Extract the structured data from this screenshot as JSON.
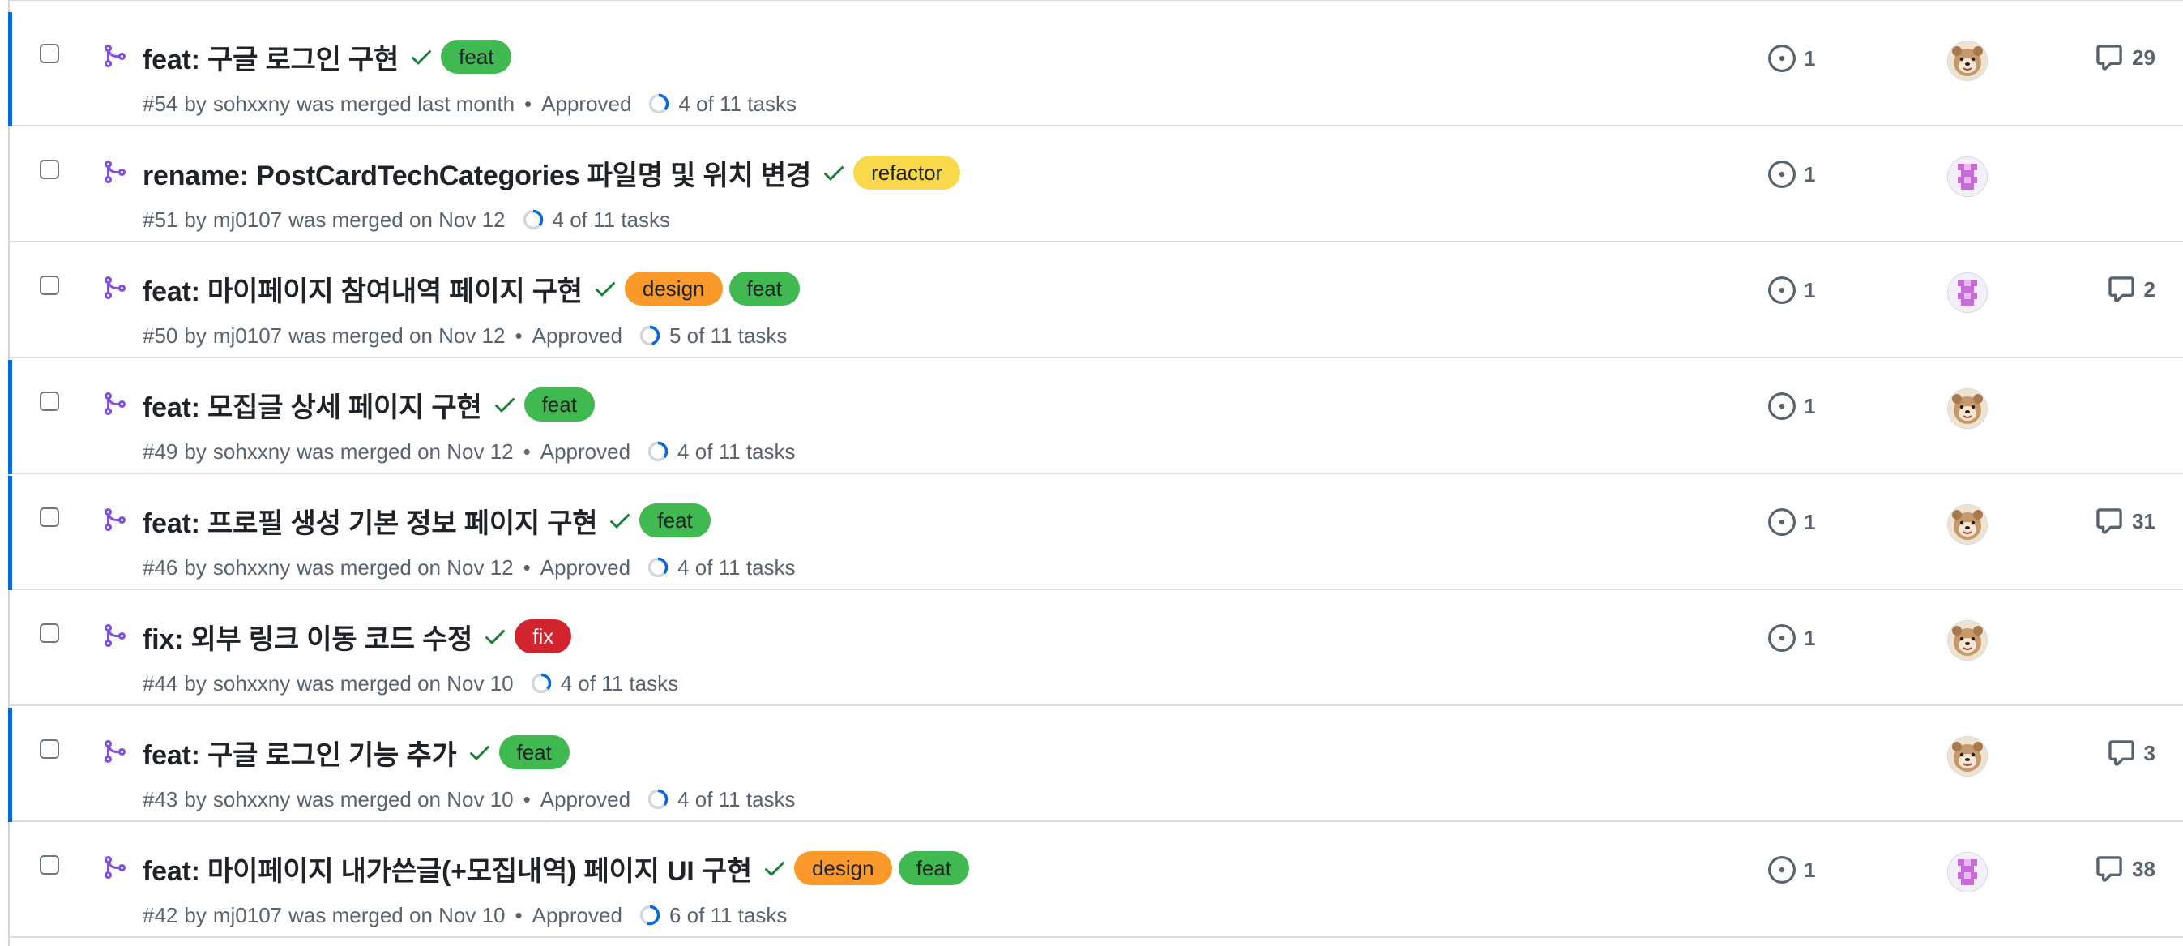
{
  "colors": {
    "feat": "#3fb950",
    "refactor": "#f9d849",
    "design": "#fb9a2b",
    "fix": "#d1242f",
    "merged_purple": "#8250df",
    "check_green": "#1a7f37",
    "progress_blue": "#0969da",
    "unread_bar": "#0969da"
  },
  "prs": [
    {
      "title": "feat: 구글 로그인 구현",
      "labels": [
        {
          "text": "feat",
          "color": "feat"
        }
      ],
      "number": "#54",
      "by": "by",
      "author": "sohxxny",
      "merged": "was merged last month",
      "approved": "Approved",
      "tasks": "4 of 11 tasks",
      "tasks_done": 4,
      "tasks_total": 11,
      "issues": "1",
      "avatar": "bear",
      "comments": "29",
      "unread": true
    },
    {
      "title": "rename: PostCardTechCategories 파일명 및 위치 변경",
      "labels": [
        {
          "text": "refactor",
          "color": "refactor"
        }
      ],
      "number": "#51",
      "by": "by",
      "author": "mj0107",
      "merged": "was merged on Nov 12",
      "approved": "",
      "tasks": "4 of 11 tasks",
      "tasks_done": 4,
      "tasks_total": 11,
      "issues": "1",
      "avatar": "pixel",
      "comments": "",
      "unread": false
    },
    {
      "title": "feat: 마이페이지 참여내역 페이지 구현",
      "labels": [
        {
          "text": "design",
          "color": "design"
        },
        {
          "text": "feat",
          "color": "feat"
        }
      ],
      "number": "#50",
      "by": "by",
      "author": "mj0107",
      "merged": "was merged on Nov 12",
      "approved": "Approved",
      "tasks": "5 of 11 tasks",
      "tasks_done": 5,
      "tasks_total": 11,
      "issues": "1",
      "avatar": "pixel",
      "comments": "2",
      "unread": false
    },
    {
      "title": "feat: 모집글 상세 페이지 구현",
      "labels": [
        {
          "text": "feat",
          "color": "feat"
        }
      ],
      "number": "#49",
      "by": "by",
      "author": "sohxxny",
      "merged": "was merged on Nov 12",
      "approved": "Approved",
      "tasks": "4 of 11 tasks",
      "tasks_done": 4,
      "tasks_total": 11,
      "issues": "1",
      "avatar": "bear",
      "comments": "",
      "unread": true
    },
    {
      "title": "feat: 프로필 생성 기본 정보 페이지 구현",
      "labels": [
        {
          "text": "feat",
          "color": "feat"
        }
      ],
      "number": "#46",
      "by": "by",
      "author": "sohxxny",
      "merged": "was merged on Nov 12",
      "approved": "Approved",
      "tasks": "4 of 11 tasks",
      "tasks_done": 4,
      "tasks_total": 11,
      "issues": "1",
      "avatar": "bear",
      "comments": "31",
      "unread": true
    },
    {
      "title": "fix: 외부 링크 이동 코드 수정",
      "labels": [
        {
          "text": "fix",
          "color": "fix"
        }
      ],
      "number": "#44",
      "by": "by",
      "author": "sohxxny",
      "merged": "was merged on Nov 10",
      "approved": "",
      "tasks": "4 of 11 tasks",
      "tasks_done": 4,
      "tasks_total": 11,
      "issues": "1",
      "avatar": "bear",
      "comments": "",
      "unread": false
    },
    {
      "title": "feat: 구글 로그인 기능 추가",
      "labels": [
        {
          "text": "feat",
          "color": "feat"
        }
      ],
      "number": "#43",
      "by": "by",
      "author": "sohxxny",
      "merged": "was merged on Nov 10",
      "approved": "Approved",
      "tasks": "4 of 11 tasks",
      "tasks_done": 4,
      "tasks_total": 11,
      "issues": "",
      "avatar": "bear",
      "comments": "3",
      "unread": true
    },
    {
      "title": "feat: 마이페이지 내가쓴글(+모집내역) 페이지 UI 구현",
      "labels": [
        {
          "text": "design",
          "color": "design"
        },
        {
          "text": "feat",
          "color": "feat"
        }
      ],
      "number": "#42",
      "by": "by",
      "author": "mj0107",
      "merged": "was merged on Nov 10",
      "approved": "Approved",
      "tasks": "6 of 11 tasks",
      "tasks_done": 6,
      "tasks_total": 11,
      "issues": "1",
      "avatar": "pixel",
      "comments": "38",
      "unread": false
    }
  ]
}
